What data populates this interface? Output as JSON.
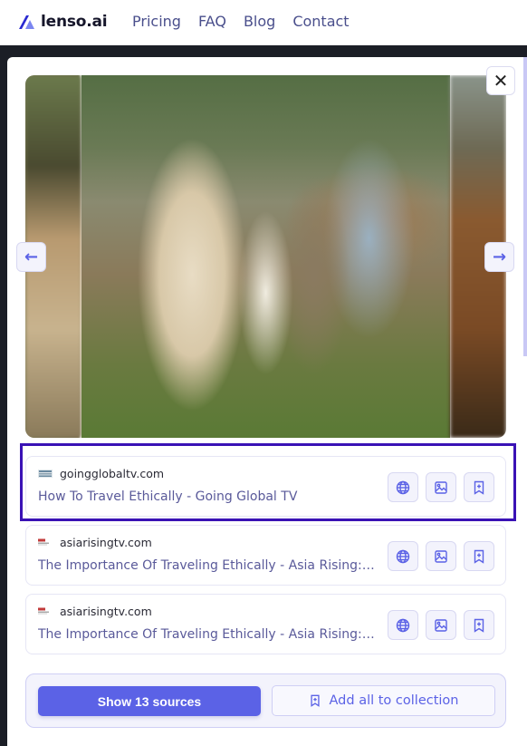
{
  "header": {
    "brand": "lenso.ai",
    "nav": [
      "Pricing",
      "FAQ",
      "Blog",
      "Contact"
    ]
  },
  "viewer": {
    "close_icon": "close-icon",
    "prev_icon": "arrow-left-icon",
    "next_icon": "arrow-right-icon",
    "close_glyph": "✕",
    "prev_glyph": "←",
    "next_glyph": "→"
  },
  "results": [
    {
      "domain": "goingglobaltv.com",
      "title": "How To Travel Ethically - Going Global TV",
      "selected": true
    },
    {
      "domain": "asiarisingtv.com",
      "title": "The Importance Of Traveling Ethically - Asia Rising: Stor...",
      "selected": false
    },
    {
      "domain": "asiarisingtv.com",
      "title": "The Importance Of Traveling Ethically - Asia Rising: Stor...",
      "selected": false
    }
  ],
  "result_actions": [
    "globe-icon",
    "image-icon",
    "bookmark-plus-icon"
  ],
  "footer": {
    "show_sources_label": "Show 13 sources",
    "add_collection_label": "Add all to collection"
  },
  "colors": {
    "accent": "#5b62e6",
    "selected_border": "#3a12b5",
    "nav_text": "#4a4f8c",
    "title_text": "#5a5a9a"
  }
}
